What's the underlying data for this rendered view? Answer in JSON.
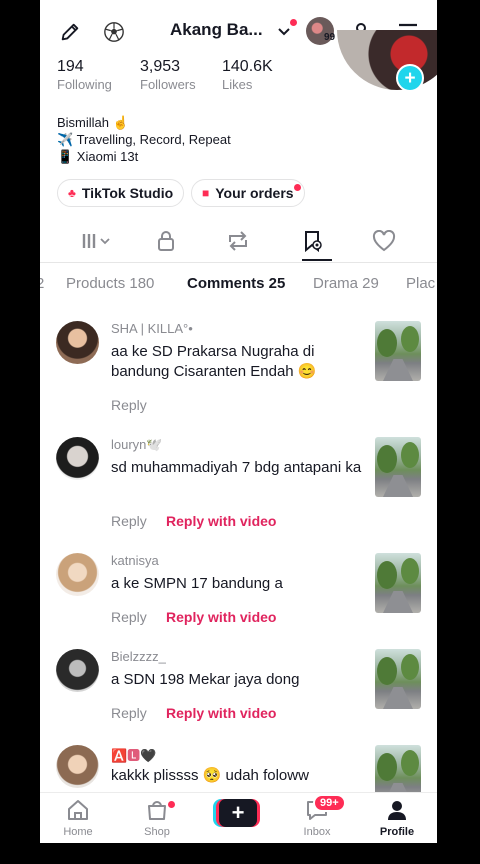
{
  "header": {
    "title": "Akang Ba...",
    "following_count_badge": "99",
    "icons": [
      "pencil-icon",
      "soccer-ball-icon",
      "chevron-down-icon",
      "add-friend-icon",
      "menu-icon"
    ]
  },
  "stats": [
    {
      "value": "194",
      "label": "Following"
    },
    {
      "value": "3,953",
      "label": "Followers"
    },
    {
      "value": "140.6K",
      "label": "Likes"
    }
  ],
  "bio": {
    "line1": "Bismillah ☝",
    "line2": "✈️ Travelling, Record, Repeat",
    "line3": "📱 Xiaomi 13t"
  },
  "chips": {
    "studio": "TikTok Studio",
    "orders": "Your orders"
  },
  "tabs": {
    "cut_left": "2",
    "products": "Products 180",
    "comments": "Comments 25",
    "drama": "Drama 29",
    "places": "Plac"
  },
  "comments": [
    {
      "user": "SHA | KILLA°•",
      "text": "aa ke SD Prakarsa Nugraha di bandung Cisaranten Endah 😊",
      "reply": "Reply",
      "reply_video": ""
    },
    {
      "user": "louryn🕊️",
      "text": "sd muhammadiyah 7 bdg antapani ka",
      "reply": "Reply",
      "reply_video": "Reply with video"
    },
    {
      "user": "katnisya",
      "text": "a ke SMPN 17 bandung a",
      "reply": "Reply",
      "reply_video": "Reply with video"
    },
    {
      "user": "Bielzzzz_",
      "text": "a SDN 198 Mekar jaya dong",
      "reply": "Reply",
      "reply_video": "Reply with video"
    },
    {
      "user": "🅰️🅻🖤",
      "text": "kakkk plissss 🥺 udah foloww",
      "reply": "",
      "reply_video": ""
    }
  ],
  "nav": {
    "home": "Home",
    "shop": "Shop",
    "inbox": "Inbox",
    "inbox_badge": "99+",
    "profile": "Profile",
    "create": "+"
  },
  "colors": {
    "accent": "#fe2c55",
    "cyan": "#20d5ec",
    "text": "#161823",
    "muted": "#8a8b91"
  }
}
